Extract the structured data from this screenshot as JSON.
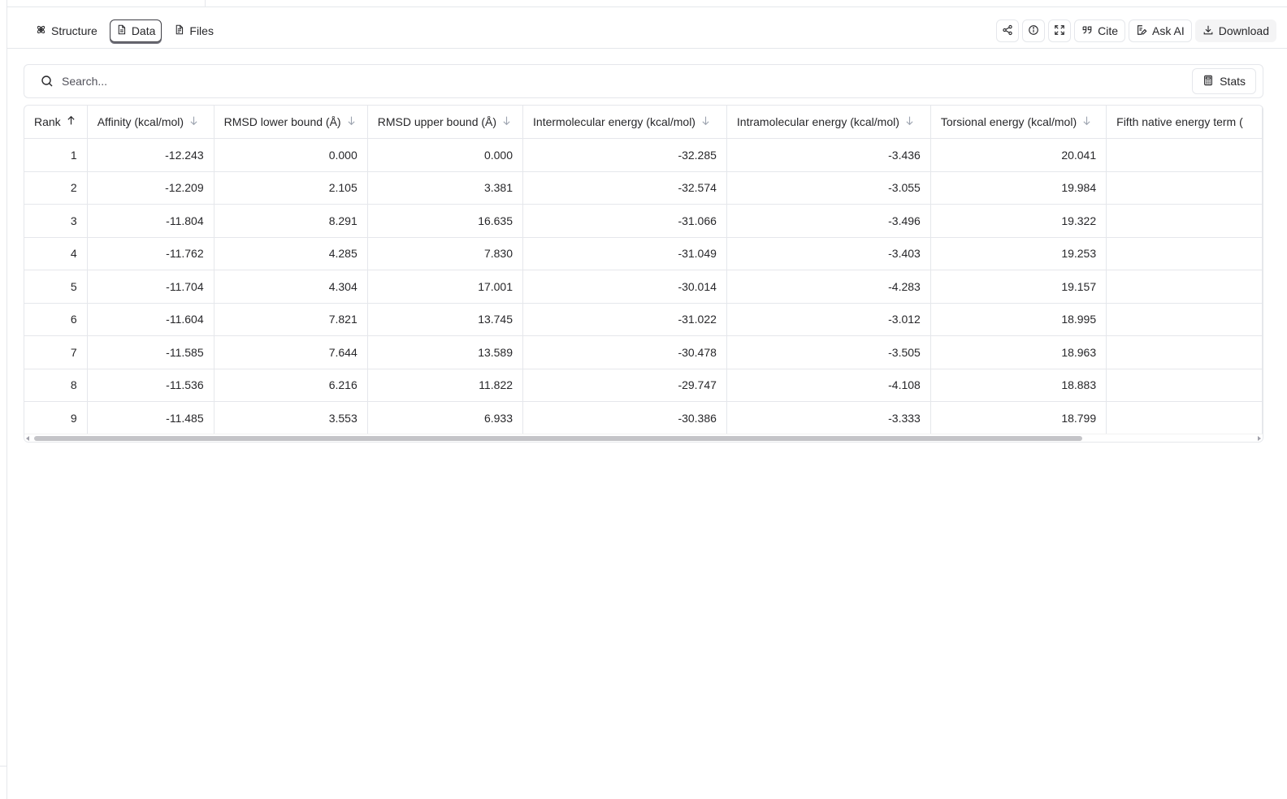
{
  "tabs": [
    {
      "label": "Structure",
      "icon": "atom-icon",
      "active": false
    },
    {
      "label": "Data",
      "icon": "file-icon",
      "active": true
    },
    {
      "label": "Files",
      "icon": "file-text-icon",
      "active": false
    }
  ],
  "toolbar": {
    "share_icon": "share-icon",
    "info_icon": "info-icon",
    "expand_icon": "expand-icon",
    "cite_label": "Cite",
    "ask_ai_label": "Ask AI",
    "download_label": "Download"
  },
  "search": {
    "placeholder": "Search...",
    "value": ""
  },
  "stats": {
    "label": "Stats"
  },
  "table": {
    "columns": [
      {
        "label": "Rank",
        "sort": "asc"
      },
      {
        "label": "Affinity (kcal/mol)",
        "sort": "desc"
      },
      {
        "label": "RMSD lower bound (Å)",
        "sort": "desc"
      },
      {
        "label": "RMSD upper bound (Å)",
        "sort": "desc"
      },
      {
        "label": "Intermolecular energy (kcal/mol)",
        "sort": "desc"
      },
      {
        "label": "Intramolecular energy (kcal/mol)",
        "sort": "desc"
      },
      {
        "label": "Torsional energy (kcal/mol)",
        "sort": "desc"
      },
      {
        "label": "Fifth native energy term (",
        "sort": "none"
      }
    ],
    "rows": [
      [
        "1",
        "-12.243",
        "0.000",
        "0.000",
        "-32.285",
        "-3.436",
        "20.041",
        ""
      ],
      [
        "2",
        "-12.209",
        "2.105",
        "3.381",
        "-32.574",
        "-3.055",
        "19.984",
        ""
      ],
      [
        "3",
        "-11.804",
        "8.291",
        "16.635",
        "-31.066",
        "-3.496",
        "19.322",
        ""
      ],
      [
        "4",
        "-11.762",
        "4.285",
        "7.830",
        "-31.049",
        "-3.403",
        "19.253",
        ""
      ],
      [
        "5",
        "-11.704",
        "4.304",
        "17.001",
        "-30.014",
        "-4.283",
        "19.157",
        ""
      ],
      [
        "6",
        "-11.604",
        "7.821",
        "13.745",
        "-31.022",
        "-3.012",
        "18.995",
        ""
      ],
      [
        "7",
        "-11.585",
        "7.644",
        "13.589",
        "-30.478",
        "-3.505",
        "18.963",
        ""
      ],
      [
        "8",
        "-11.536",
        "6.216",
        "11.822",
        "-29.747",
        "-4.108",
        "18.883",
        ""
      ],
      [
        "9",
        "-11.485",
        "3.553",
        "6.933",
        "-30.386",
        "-3.333",
        "18.799",
        ""
      ]
    ]
  }
}
